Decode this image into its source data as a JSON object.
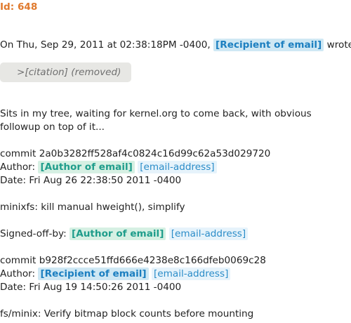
{
  "email": {
    "id_label": "Id: 648",
    "quote_intro": {
      "prefix": "On Thu, Sep 29, 2011 at 02:38:18PM -0400,",
      "sender": "[Recipient of email]",
      "suffix": "wrote:"
    },
    "citation": ">[citation] (removed)",
    "body_line_1": "Sits in my tree, waiting for kernel.org to come back, with obvious",
    "body_line_2": "followup on top of it...",
    "commit1": {
      "hash_line": "commit 2a0b3282ff528af4c0824c16d99c62a53d029720",
      "author_label": "Author:",
      "author_name": "[Author of email]",
      "author_email": "[email-address]",
      "date_line": "Date: Fri Aug 26 22:38:50 2011 -0400",
      "subject": "minixfs: kill manual hweight(), simplify",
      "signoff_label": "Signed-off-by:",
      "signoff_name": "[Author of email]",
      "signoff_email": "[email-address]"
    },
    "commit2": {
      "hash_line": "commit b928f2ccce51ffd666e4238e8c166dfeb0069c28",
      "author_label": "Author:",
      "author_name": "[Recipient of email]",
      "author_email": "[email-address]",
      "date_line": "Date: Fri Aug 19 14:50:26 2011 -0400",
      "subject": "fs/minix: Verify bitmap block counts before mounting"
    }
  },
  "colors": {
    "id_accent": "#e07a2e",
    "badge_recipient": "#1c7fc0",
    "badge_author": "#1f9d8b",
    "citation_bg": "#e7e7e4"
  }
}
